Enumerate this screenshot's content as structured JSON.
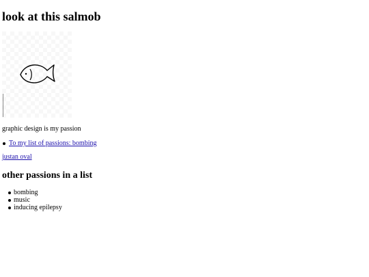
{
  "page": {
    "title": "look at this salmob",
    "caption": "graphic design is my passion",
    "image": {
      "icon": "fish-icon"
    },
    "links": [
      {
        "label": "To my list of passions: bombing"
      }
    ],
    "author_link": "justan oval"
  },
  "passions": {
    "heading": "other passions in a list",
    "items": [
      "bombing",
      "music",
      "inducing epilepsy"
    ]
  }
}
